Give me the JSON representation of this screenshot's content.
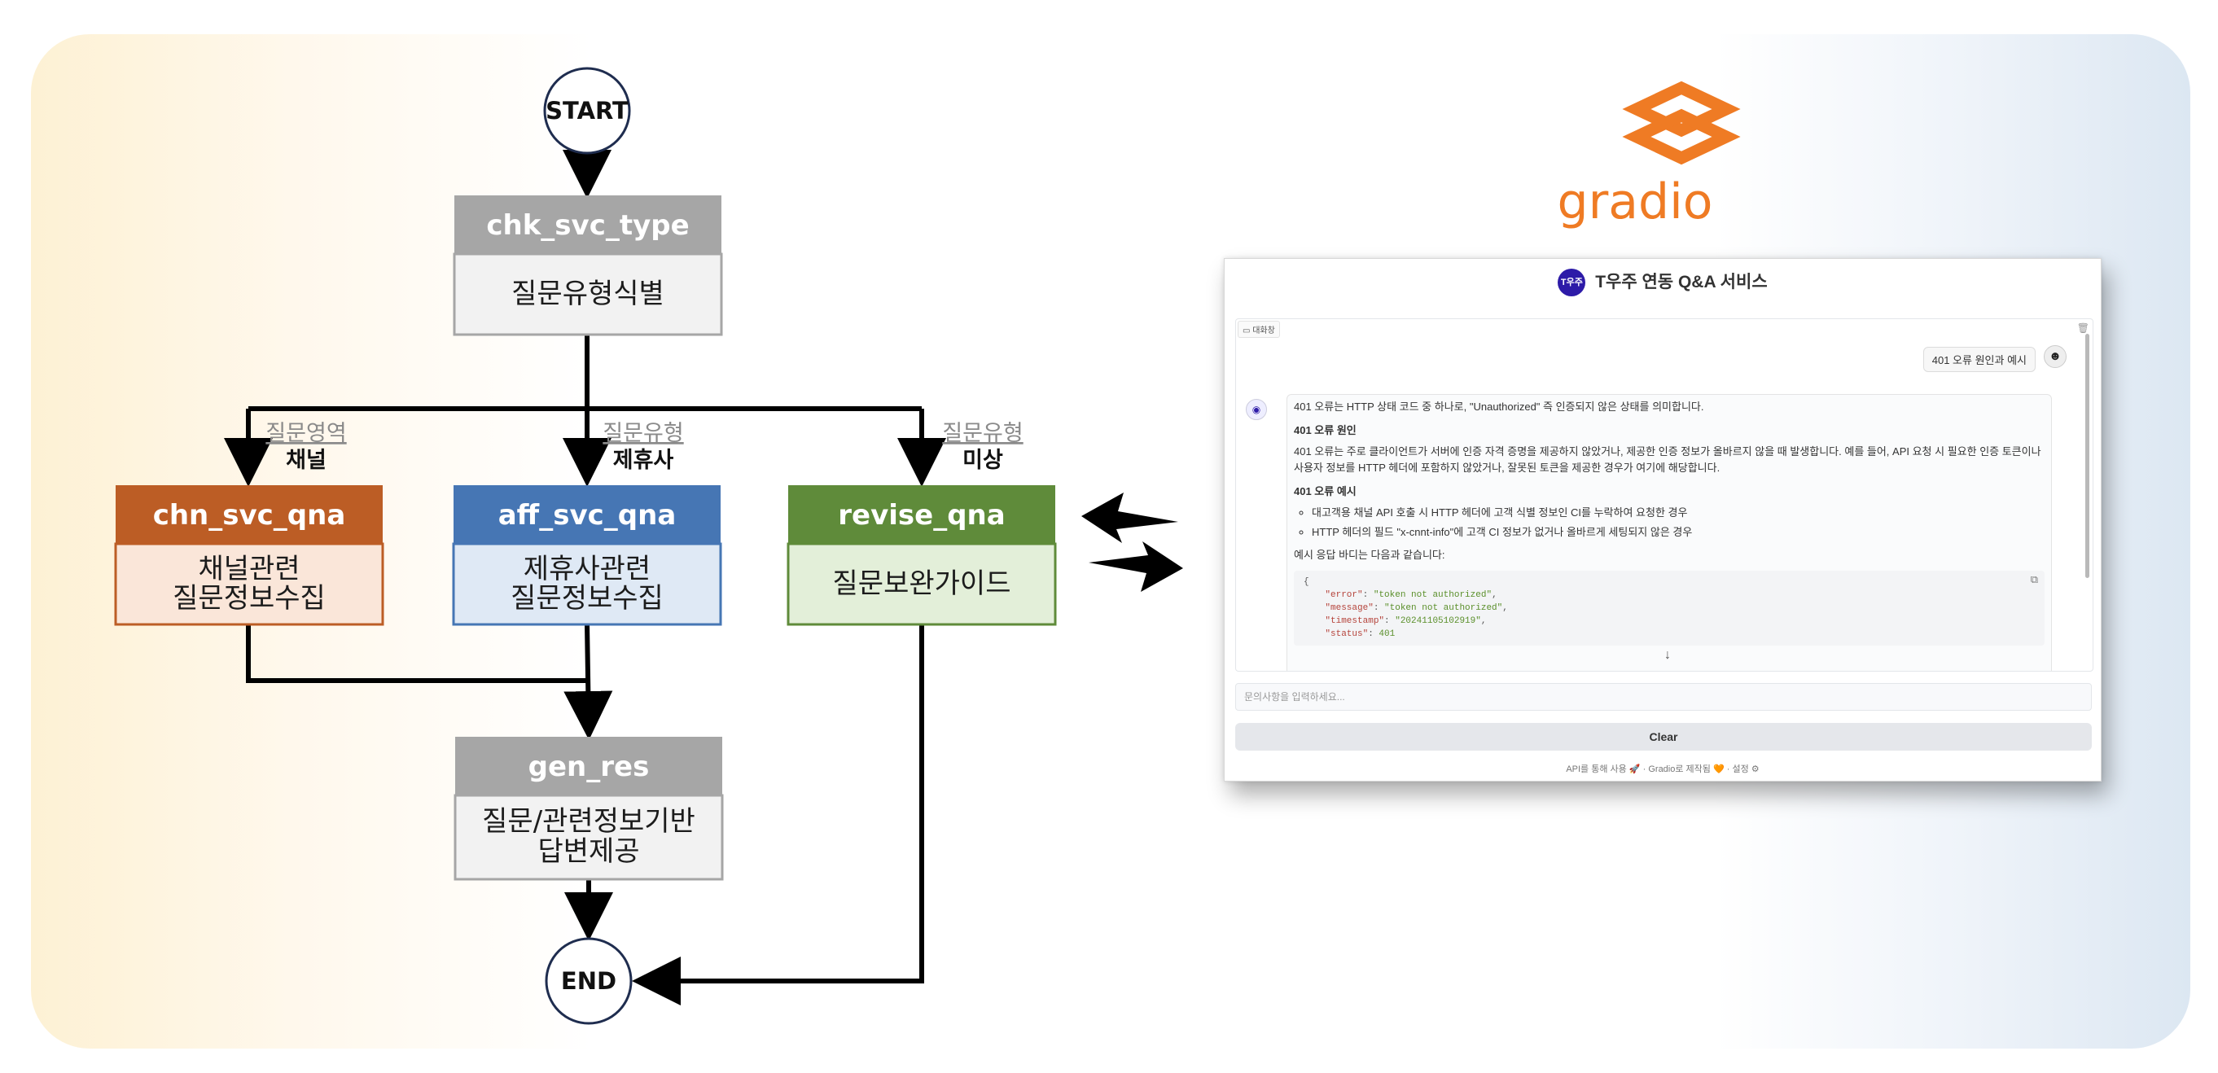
{
  "diagram": {
    "start": "START",
    "end": "END",
    "nodes": {
      "chk": {
        "title": "chk_svc_type",
        "body": "질문유형식별"
      },
      "chn": {
        "title": "chn_svc_qna",
        "body1": "채널관련",
        "body2": "질문정보수집"
      },
      "aff": {
        "title": "aff_svc_qna",
        "body1": "제휴사관련",
        "body2": "질문정보수집"
      },
      "rev": {
        "title": "revise_qna",
        "body": "질문보완가이드"
      },
      "gen": {
        "title": "gen_res",
        "body1": "질문/관련정보기반",
        "body2": "답변제공"
      }
    },
    "edge_labels": {
      "chn": {
        "line1": "질문영역",
        "line2": "채널"
      },
      "aff": {
        "line1": "질문유형",
        "line2": "제휴사"
      },
      "rev": {
        "line1": "질문유형",
        "line2": "미상"
      }
    },
    "colors": {
      "chk_header": "#a6a6a6",
      "chk_body": "#f2f2f2",
      "chn_header": "#bc5d25",
      "chn_body": "#fae6d9",
      "aff_header": "#4676b4",
      "aff_body": "#dfe9f5",
      "rev_header": "#5f8b3a",
      "rev_body": "#e3efd9",
      "gradio_orange": "#ef7b24"
    }
  },
  "logo": {
    "word": "gradio",
    "icon": "gradio-logo-icon"
  },
  "app": {
    "logo_text": "T우주",
    "title": "T우주 연동 Q&A 서비스",
    "chat_tag": "대화창",
    "user_message": "401 오류 원인과 예시",
    "bot": {
      "p1": "401 오류는 HTTP 상태 코드 중 하나로, \"Unauthorized\" 즉 인증되지 않은 상태를 의미합니다.",
      "h1": "401 오류 원인",
      "p2": "401 오류는 주로 클라이언트가 서버에 인증 자격 증명을 제공하지 않았거나, 제공한 인증 정보가 올바르지 않을 때 발생합니다. 예를 들어, API 요청 시 필요한 인증 토큰이나 사용자 정보를 HTTP 헤더에 포함하지 않았거나, 잘못된 토큰을 제공한 경우가 여기에 해당합니다.",
      "h2": "401 오류 예시",
      "li1": "대고객용 채널 API 호출 시 HTTP 헤더에 고객 식별 정보인 CI를 누락하여 요청한 경우",
      "li2": "HTTP 헤더의 필드 \"x-cnnt-info\"에 고객 CI 정보가 없거나 올바르게 세팅되지 않은 경우",
      "p3": "예시 응답 바디는 다음과 같습니다:",
      "code_open": "{",
      "code_error_key": "\"error\"",
      "code_error_val": "\"token not authorized\"",
      "code_message_key": "\"message\"",
      "code_message_val": "\"token not authorized\"",
      "code_timestamp_key": "\"timestamp\"",
      "code_timestamp_val": "\"20241105102919\"",
      "code_status_key": "\"status\"",
      "code_status_val": "401"
    },
    "input_placeholder": "문의사항을 입력하세요...",
    "clear_label": "Clear",
    "footer": {
      "api": "API를 통해 사용",
      "sep1": "·",
      "built": "Gradio로 제작됨",
      "sep2": "·",
      "settings": "설정"
    }
  }
}
